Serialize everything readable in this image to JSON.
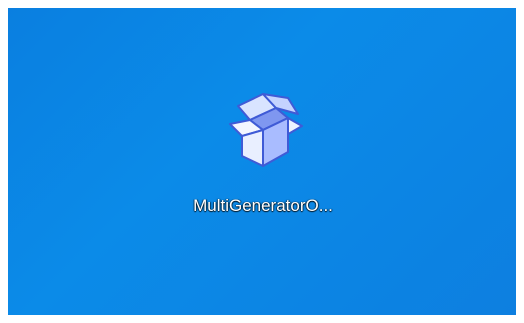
{
  "desktop": {
    "background_color": "#0b86e6",
    "icons": [
      {
        "label": "MultiGeneratorO...",
        "icon": "package-box-icon"
      }
    ]
  }
}
